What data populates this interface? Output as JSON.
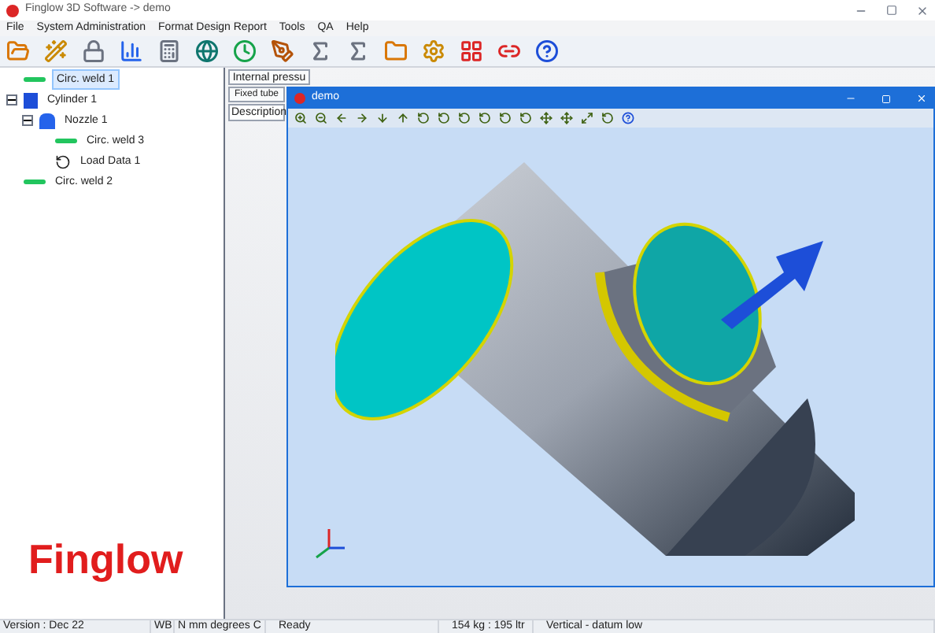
{
  "window": {
    "title": "Finglow 3D Software -> demo"
  },
  "menu": [
    "File",
    "System Administration",
    "Format Design Report",
    "Tools",
    "QA",
    "Help"
  ],
  "tree": [
    {
      "label": "Circ. weld 1",
      "kind": "weld",
      "selected": true
    },
    {
      "label": "Cylinder 1",
      "kind": "cylinder",
      "selected": false,
      "expanded": true,
      "children": [
        {
          "label": "Nozzle 1",
          "kind": "nozzle",
          "selected": false,
          "expanded": true,
          "children": [
            {
              "label": "Circ. weld 3",
              "kind": "weld",
              "selected": false
            },
            {
              "label": "Load Data 1",
              "kind": "load",
              "selected": false
            }
          ]
        }
      ]
    },
    {
      "label": "Circ. weld 2",
      "kind": "weld",
      "selected": false
    }
  ],
  "tabs_row1": [
    "Internal pressu"
  ],
  "tabs_row2": [
    "Fixed tube"
  ],
  "description_header": "Description",
  "viewer": {
    "title": "demo"
  },
  "logo": "Finglow",
  "status_bar": [
    "Version : Dec 22",
    "WB",
    "N mm degrees C",
    "Ready",
    "154 kg : 195 ltr",
    "Vertical  - datum low"
  ]
}
